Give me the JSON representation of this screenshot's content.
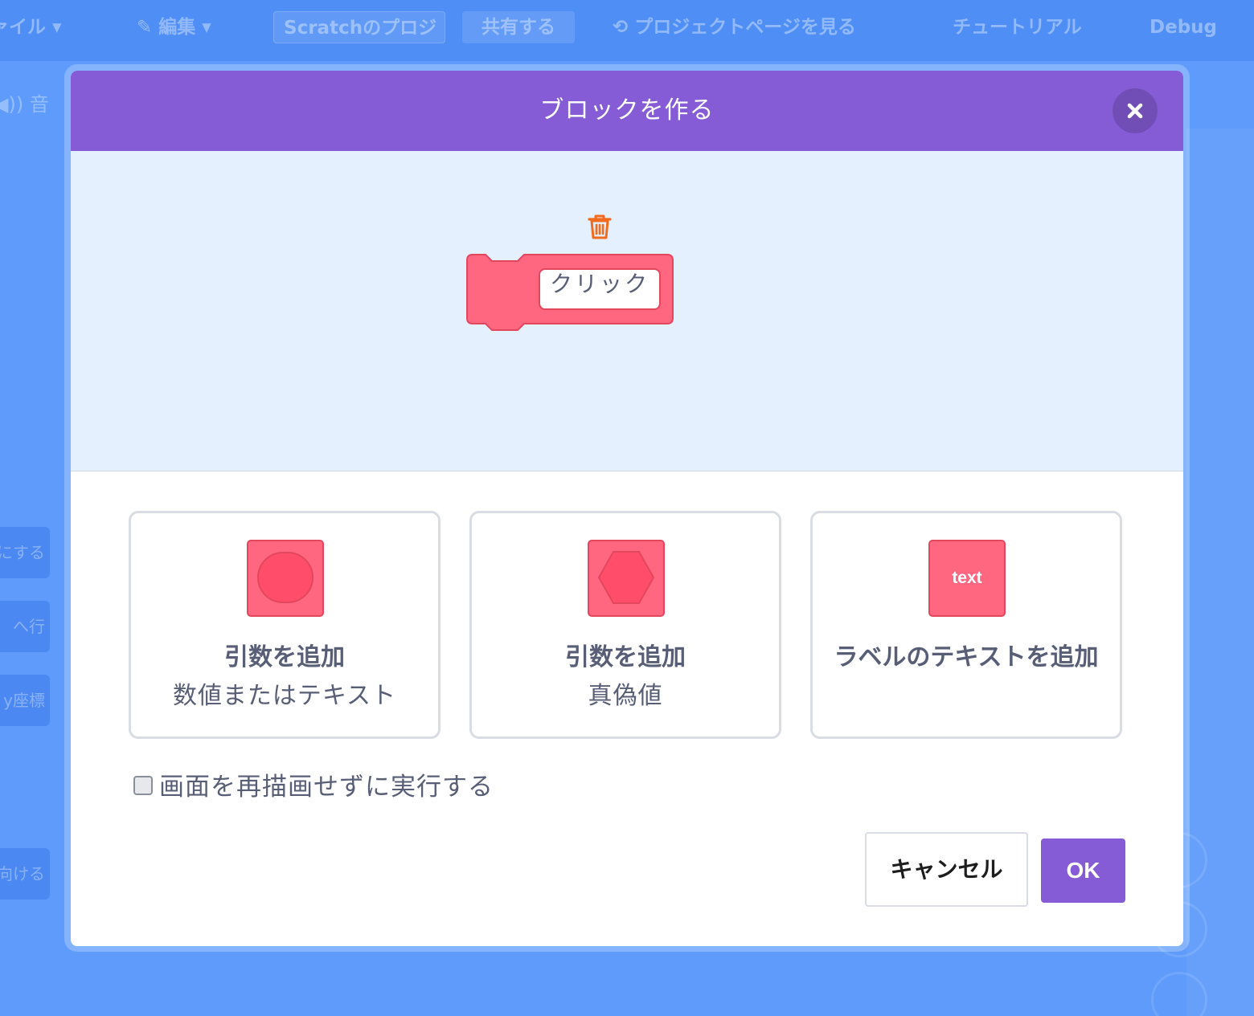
{
  "menubar": {
    "file": "ァイル ▾",
    "edit": "✎ 編集 ▾",
    "project_title": "Scratchのプロジ",
    "share": "共有する",
    "see_project_page": "⟲ プロジェクトページを見る",
    "tutorials": "チュートリアル",
    "debug": "Debug"
  },
  "background": {
    "sounds_tab": "◀)) 音",
    "block_1": "にする",
    "block_2": "へ行",
    "block_3": "y座標",
    "block_4": "向ける"
  },
  "modal": {
    "title": "ブロックを作る",
    "block_label": "クリック",
    "options": [
      {
        "title": "引数を追加",
        "subtitle": "数値またはテキスト"
      },
      {
        "title": "引数を追加",
        "subtitle": "真偽値"
      },
      {
        "title": "ラベルのテキストを追加",
        "subtitle": ""
      }
    ],
    "label_icon_text": "text",
    "run_without_refresh": "画面を再描画せずに実行する",
    "run_without_refresh_checked": false,
    "cancel": "キャンセル",
    "ok": "OK"
  },
  "colors": {
    "header": "#855cd6",
    "block": "#ff6680",
    "workspace": "#e5f0ff",
    "background": "#5e9bfb",
    "text": "#575e75",
    "trash": "#f26b1d"
  },
  "icons": {
    "close": "close-icon",
    "trash": "trash-icon",
    "number_text_input": "rounded-input-icon",
    "boolean_input": "hexagon-input-icon",
    "label": "text-label-icon"
  }
}
